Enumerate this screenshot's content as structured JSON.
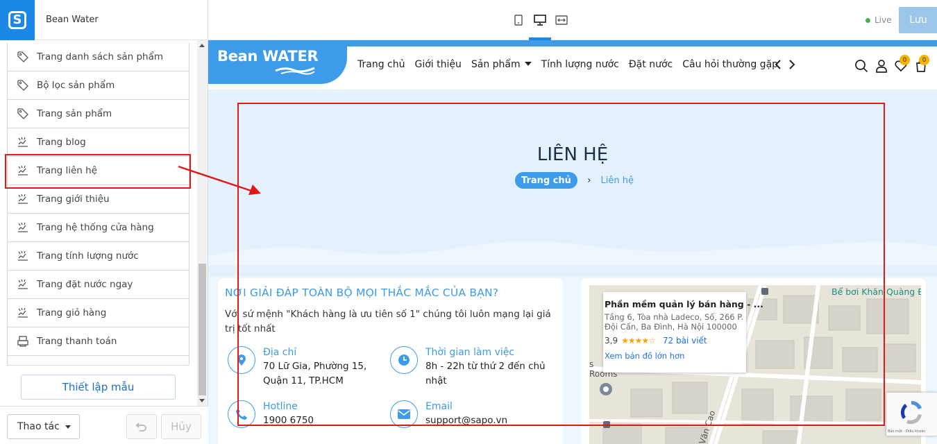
{
  "editor": {
    "store_name": "Bean Water",
    "logo_letter": "S",
    "pages": [
      {
        "label": "Trang danh sách sản phẩm",
        "icon": "tag-icon"
      },
      {
        "label": "Bộ lọc sản phẩm",
        "icon": "tag-icon"
      },
      {
        "label": "Trang sản phẩm",
        "icon": "tag-icon"
      },
      {
        "label": "Trang blog",
        "icon": "layout-icon"
      },
      {
        "label": "Trang liên hệ",
        "icon": "layout-icon"
      },
      {
        "label": "Trang giới thiệu",
        "icon": "layout-icon"
      },
      {
        "label": "Trang hệ thống cửa hàng",
        "icon": "layout-icon"
      },
      {
        "label": "Trang tính lượng nước",
        "icon": "layout-icon"
      },
      {
        "label": "Trang đặt nước ngay",
        "icon": "layout-icon"
      },
      {
        "label": "Trang giỏ hàng",
        "icon": "layout-icon"
      },
      {
        "label": "Trang thanh toán",
        "icon": "printer-icon"
      }
    ],
    "selected_page": "Trang liên hệ",
    "template_button": "Thiết lập mẫu",
    "actions_label": "Thao tác",
    "cancel_label": "Hủy",
    "live_label": "Live",
    "save_label": "Lưu",
    "selected_device": "desktop"
  },
  "site": {
    "brand": "Bean WATER",
    "nav": [
      "Trang chủ",
      "Giới thiệu",
      "Sản phẩm",
      "Tính lượng nước",
      "Đặt nước",
      "Câu hỏi thường gặp"
    ],
    "wishlist_count": "0",
    "cart_count": "0",
    "colors": {
      "primary": "#3d9bea",
      "highlight": "#e01818"
    },
    "hero": {
      "title": "LIÊN HỆ",
      "breadcrumb_home": "Trang chủ",
      "breadcrumb_current": "Liên hệ"
    },
    "contact": {
      "title": "NƠI GIẢI ĐÁP TOÀN BỘ MỌI THẮC MẮC CỦA BẠN?",
      "description": "Với sứ mệnh \"Khách hàng là ưu tiên số 1\" chúng tôi luôn mạng lại giá trị tốt nhất",
      "address_label": "Địa chỉ",
      "address_line1": "70 Lữ Gia, Phường 15,",
      "address_line2": "Quận 11, TP.HCM",
      "hours_label": "Thời gian làm việc",
      "hours_line1": "8h - 22h từ thứ 2 đến chủ",
      "hours_line2": "nhật",
      "hotline_label": "Hotline",
      "hotline_value": "1900 6750",
      "email_label": "Email",
      "email_value": "support@sapo.vn"
    },
    "map": {
      "place_name": "Phần mềm quản lý bán hàng - ...",
      "address_line1": "Tầng 6, Tòa nhà Ladeco, Số, 266 P.",
      "address_line2": "Đội Cấn, Ba Đình, Hà Nội 100000",
      "rating": "3,9",
      "stars": "★★★★☆",
      "reviews": "72 bài viết",
      "larger_map": "Xem bản đồ lớn hơn",
      "nearby": "Bể bơi Khăn Quàng Đ",
      "map_text_1": "s",
      "map_text_2": "Rooms",
      "map_text_3": "Văn Cao"
    },
    "recaptcha_text": "Bảo mật - Điều khoản"
  }
}
